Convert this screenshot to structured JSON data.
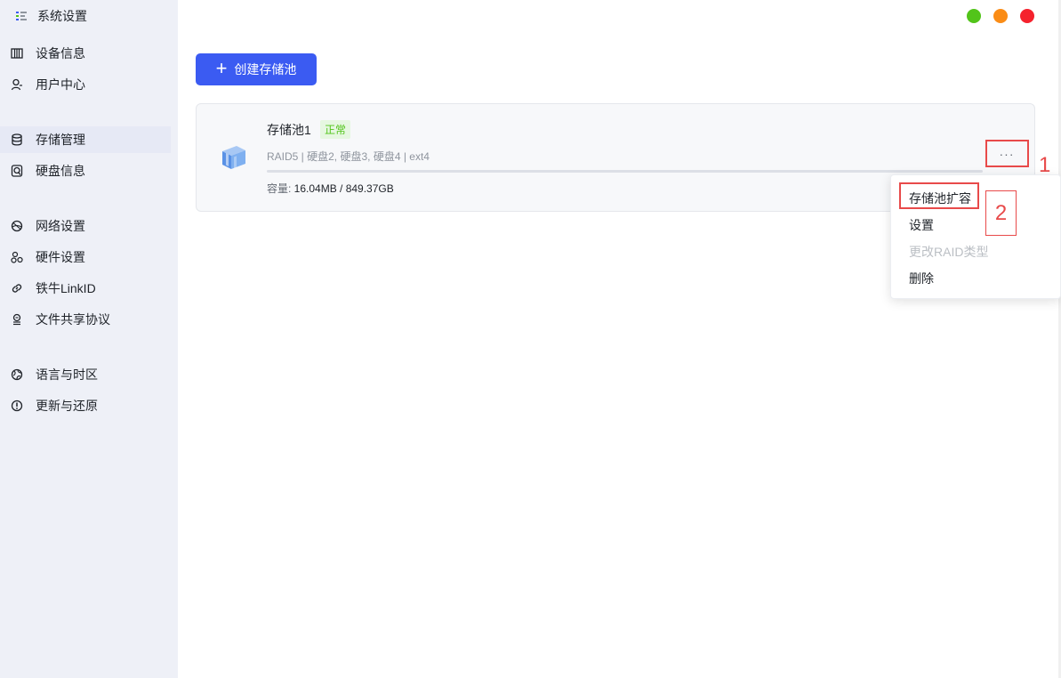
{
  "sidebar": {
    "app_title": "系统设置",
    "items": [
      {
        "label": "设备信息",
        "icon": "device-info-icon"
      },
      {
        "label": "用户中心",
        "icon": "user-icon"
      },
      {
        "label": "存储管理",
        "icon": "database-icon"
      },
      {
        "label": "硬盘信息",
        "icon": "disk-icon"
      },
      {
        "label": "网络设置",
        "icon": "network-icon"
      },
      {
        "label": "硬件设置",
        "icon": "hardware-icon"
      },
      {
        "label": "铁牛LinkID",
        "icon": "link-icon"
      },
      {
        "label": "文件共享协议",
        "icon": "file-share-icon"
      },
      {
        "label": "语言与时区",
        "icon": "globe-icon"
      },
      {
        "label": "更新与还原",
        "icon": "info-icon"
      }
    ],
    "active_index": 2
  },
  "window_controls": {
    "colors": {
      "green": "#52c41a",
      "orange": "#fa8c16",
      "red": "#f5222d"
    }
  },
  "main": {
    "create_button_label": "创建存储池",
    "pool": {
      "name": "存储池1",
      "status": "正常",
      "meta": "RAID5 | 硬盘2, 硬盘3, 硬盘4 | ext4",
      "capacity_label": "容量: ",
      "capacity_value": "16.04MB / 849.37GB",
      "used_fraction": 2e-05
    },
    "more_button_label": "···",
    "menu": [
      {
        "label": "存储池扩容",
        "disabled": false
      },
      {
        "label": "设置",
        "disabled": false
      },
      {
        "label": "更改RAID类型",
        "disabled": true
      },
      {
        "label": "删除",
        "disabled": false
      }
    ]
  },
  "annotations": {
    "step1": "1",
    "step2": "2",
    "color": "#e84a4a"
  },
  "colors": {
    "accent": "#3b5bf2",
    "status_green": "#52c41a",
    "sidebar_bg": "#eef0f7"
  }
}
